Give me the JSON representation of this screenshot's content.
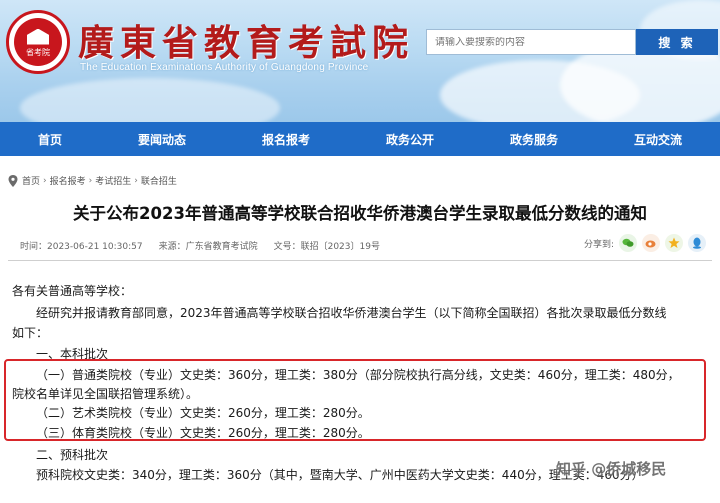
{
  "header": {
    "logo_text": "省考院",
    "site_title": "廣東省教育考試院",
    "site_subtitle": "The Education Examinations Authority of Guangdong Province",
    "search_placeholder": "请输入要搜索的内容",
    "search_button": "搜 索"
  },
  "nav": {
    "items": [
      "首页",
      "要闻动态",
      "报名报考",
      "政务公开",
      "政务服务",
      "互动交流"
    ]
  },
  "breadcrumb": [
    "首页",
    "报名报考",
    "考试招生",
    "联合招生"
  ],
  "article": {
    "title": "关于公布2023年普通高等学校联合招收华侨港澳台学生录取最低分数线的通知",
    "time": "时间：2023-06-21 10:30:57",
    "source": "来源：广东省教育考试院",
    "doc_no": "文号：联招〔2023〕19号",
    "share_label": "分享到:"
  },
  "body": {
    "l1": "各有关普通高等学校：",
    "l2": "经研究并报请教育部同意，2023年普通高等学校联合招收华侨港澳台学生（以下简称全国联招）各批次录取最低分数线",
    "l3": "如下：",
    "l4": "一、本科批次",
    "l5": "（一）普通类院校（专业）文史类：360分，理工类：380分（部分院校执行高分线，文史类：460分，理工类：480分，",
    "l6": "院校名单详见全国联招管理系统）。",
    "l7": "（二）艺术类院校（专业）文史类：260分，理工类：280分。",
    "l8": "（三）体育类院校（专业）文史类：260分，理工类：280分。",
    "l9": "二、预科批次",
    "l10": "预科院校文史类：340分，理工类：360分（其中，暨南大学、广州中医药大学文史类：440分，理工类：460分）"
  },
  "watermark": "知乎 @侨城移民",
  "colors": {
    "nav_bg": "#1f6cc8",
    "search_btn": "#1e63b8",
    "title_red": "#b31b1b",
    "highlight_box": "#d8262a"
  }
}
